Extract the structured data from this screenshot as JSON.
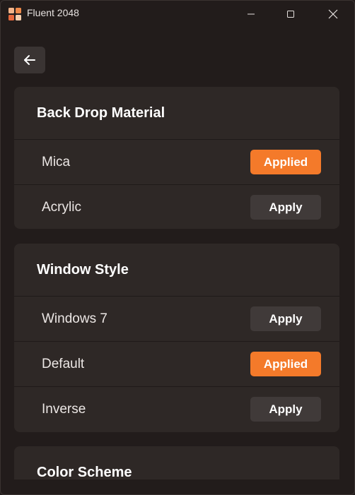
{
  "window": {
    "title": "Fluent 2048",
    "icon": "fluent-2048-app-icon"
  },
  "navigation": {
    "back_icon": "arrow-left-icon"
  },
  "sections": [
    {
      "title": "Back Drop Material",
      "options": [
        {
          "label": "Mica",
          "button": "Applied",
          "applied": true
        },
        {
          "label": "Acrylic",
          "button": "Apply",
          "applied": false
        }
      ]
    },
    {
      "title": "Window Style",
      "options": [
        {
          "label": "Windows 7",
          "button": "Apply",
          "applied": false
        },
        {
          "label": "Default",
          "button": "Applied",
          "applied": true
        },
        {
          "label": "Inverse",
          "button": "Apply",
          "applied": false
        }
      ]
    },
    {
      "title": "Color Scheme",
      "options": []
    }
  ],
  "colors": {
    "accent": "#f47a2a",
    "button_neutral": "#403a39",
    "card_background": "#2e2826",
    "window_background": "#221c1b"
  }
}
